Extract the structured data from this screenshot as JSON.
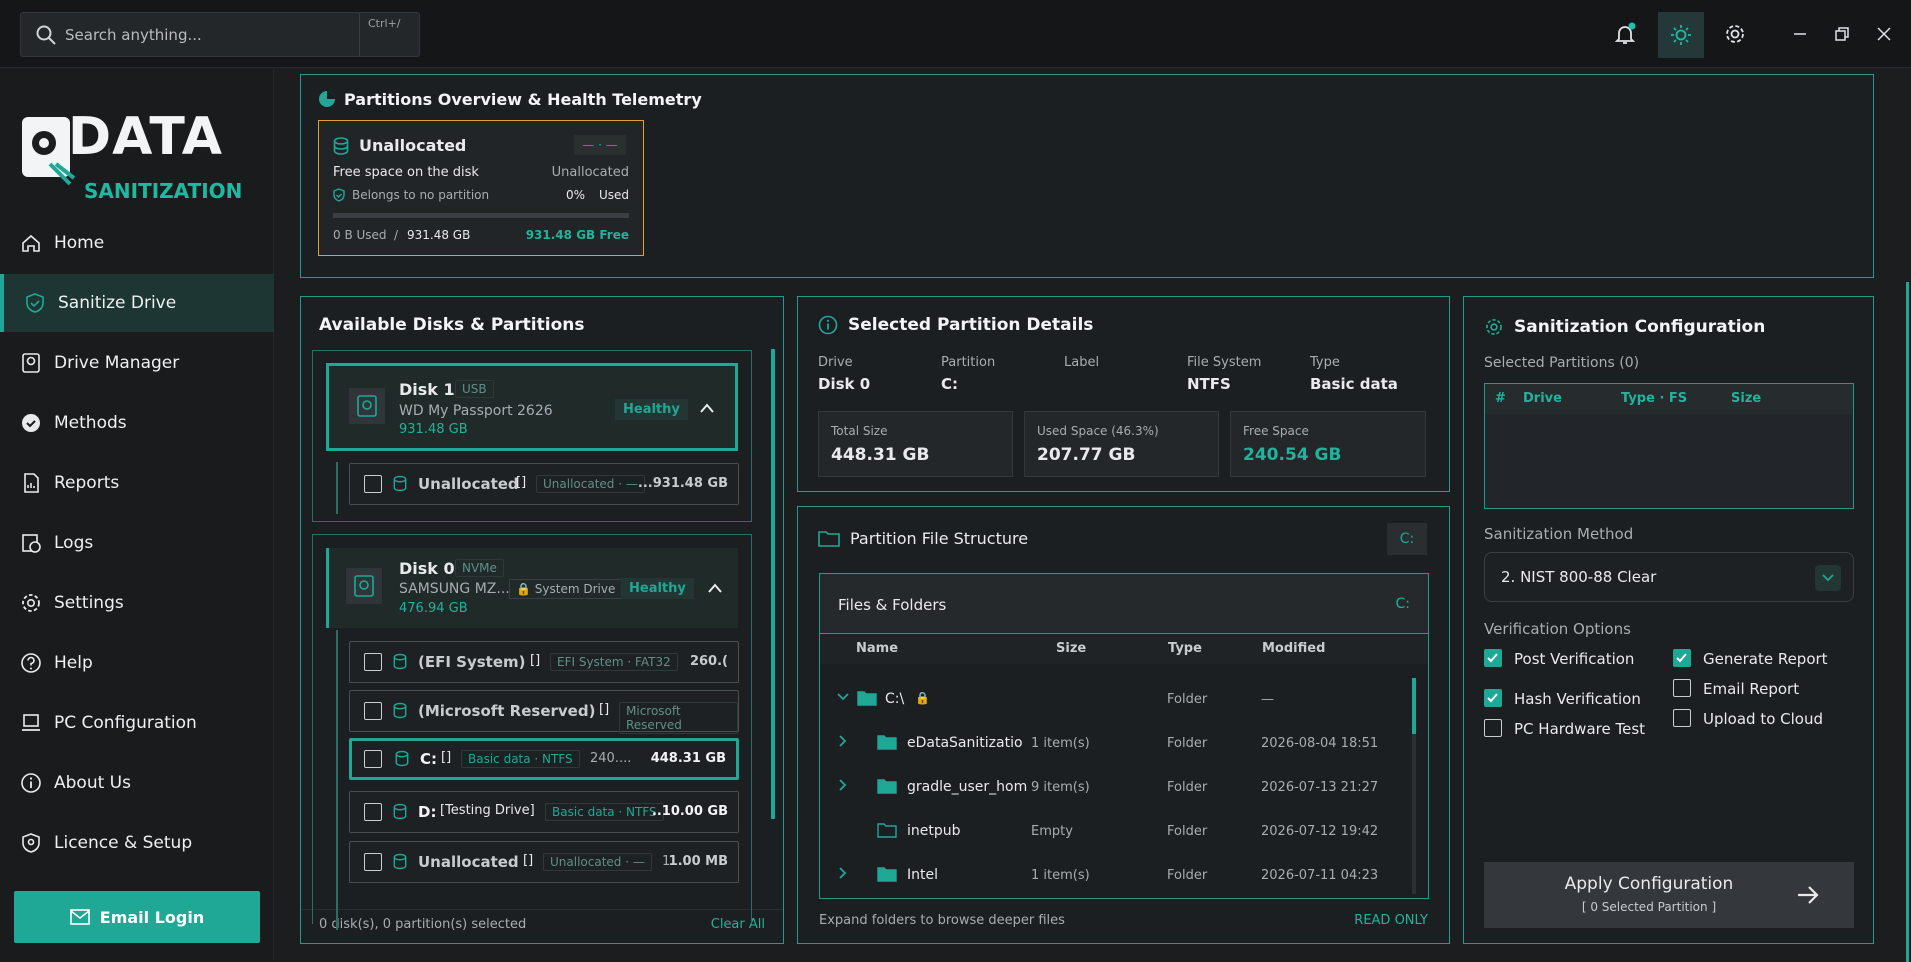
{
  "header": {
    "search_placeholder": "Search anything...",
    "shortcut": "Ctrl+/"
  },
  "brand": {
    "line1": "DATA",
    "line2": "SANITIZATION"
  },
  "nav": [
    {
      "label": "Home",
      "icon": "home-icon"
    },
    {
      "label": "Sanitize Drive",
      "icon": "shield-icon"
    },
    {
      "label": "Drive Manager",
      "icon": "drive-icon"
    },
    {
      "label": "Methods",
      "icon": "badge-check-icon"
    },
    {
      "label": "Reports",
      "icon": "report-icon"
    },
    {
      "label": "Logs",
      "icon": "logs-icon"
    },
    {
      "label": "Settings",
      "icon": "gear-icon"
    },
    {
      "label": "Help",
      "icon": "help-icon"
    },
    {
      "label": "PC Configuration",
      "icon": "laptop-icon"
    },
    {
      "label": "About Us",
      "icon": "info-icon"
    },
    {
      "label": "Licence & Setup",
      "icon": "license-icon"
    }
  ],
  "email_login": "Email Login",
  "overview": {
    "title": "Partitions Overview & Health Telemetry",
    "card": {
      "name": "Unallocated",
      "badge": "— · —",
      "desc": "Free space on the disk",
      "type": "Unallocated",
      "note": "Belongs to no partition",
      "pct": "0%",
      "pct_label": "Used",
      "used": "0 B Used",
      "sep": "/",
      "total": "931.48 GB",
      "free": "931.48 GB Free"
    }
  },
  "disks": {
    "title": "Available Disks & Partitions",
    "disk1": {
      "name": "Disk 1",
      "bus": "USB",
      "model": "WD My Passport 2626",
      "size": "931.48 GB",
      "health": "Healthy"
    },
    "disk1_parts": [
      {
        "name": "Unallocated",
        "bracket": "[]",
        "pill": "Unallocated · —",
        "size": "...931.48 GB"
      }
    ],
    "disk0": {
      "name": "Disk 0",
      "bus": "NVMe",
      "model": "SAMSUNG MZ...",
      "system": "System Drive",
      "size": "476.94 GB",
      "health": "Healthy"
    },
    "disk0_parts": [
      {
        "name": "(EFI System)",
        "bracket": "[]",
        "pill": "EFI System · FAT32",
        "size": "260.("
      },
      {
        "name": "(Microsoft Reserved)",
        "bracket": "[]",
        "pill": "Microsoft Reserved",
        "size": ""
      },
      {
        "name": "C:",
        "bracket": "[]",
        "pill": "Basic data · NTFS",
        "extra": "240....",
        "size": "448.31 GB"
      },
      {
        "name": "D:",
        "bracket": "[Testing Drive]",
        "pill": "Basic data · NTFS",
        "size": "..10.00 GB"
      },
      {
        "name": "Unallocated",
        "bracket": "[]",
        "pill": "Unallocated · —",
        "extra": "1....",
        "size": "1.00 MB"
      }
    ],
    "footer": "0 disk(s), 0 partition(s) selected",
    "clear": "Clear All"
  },
  "details": {
    "title": "Selected Partition Details",
    "cols": [
      {
        "k": "Drive",
        "v": "Disk 0"
      },
      {
        "k": "Partition",
        "v": "C:"
      },
      {
        "k": "Label",
        "v": ""
      },
      {
        "k": "File System",
        "v": "NTFS"
      },
      {
        "k": "Type",
        "v": "Basic data"
      }
    ],
    "total_label": "Total Size",
    "total": "448.31 GB",
    "used_label": "Used Space (46.3%)",
    "used": "207.77 GB",
    "free_label": "Free Space",
    "free": "240.54 GB"
  },
  "files": {
    "title": "Partition File Structure",
    "drive": "C:",
    "sub": "Files & Folders",
    "sub_drive": "C:",
    "cols": [
      "Name",
      "Size",
      "Type",
      "Modified"
    ],
    "root": {
      "name": "C:\\",
      "type": "Folder",
      "modified": "—"
    },
    "rows": [
      {
        "name": "eDataSanitizatio",
        "size": "1 item(s)",
        "type": "Folder",
        "modified": "2026-08-04 18:51",
        "expand": true
      },
      {
        "name": "gradle_user_hom",
        "size": "9 item(s)",
        "type": "Folder",
        "modified": "2026-07-13 21:27",
        "expand": true
      },
      {
        "name": "inetpub",
        "size": "Empty",
        "type": "Folder",
        "modified": "2026-07-12 19:42",
        "expand": false
      },
      {
        "name": "Intel",
        "size": "1 item(s)",
        "type": "Folder",
        "modified": "2026-07-11 04:23",
        "expand": true
      }
    ],
    "footer": "Expand folders to browse deeper files",
    "readonly": "READ ONLY"
  },
  "config": {
    "title": "Sanitization Configuration",
    "selected": "Selected Partitions (0)",
    "table_cols": [
      "#",
      "Drive",
      "Type · FS",
      "Size"
    ],
    "method_label": "Sanitization Method",
    "method": "2. NIST 800-88 Clear",
    "verify_label": "Verification Options",
    "options": [
      {
        "label": "Post Verification",
        "checked": true
      },
      {
        "label": "Generate Report",
        "checked": true
      },
      {
        "label": "Email Report",
        "checked": false
      },
      {
        "label": "Hash Verification",
        "checked": true
      },
      {
        "label": "PC Hardware Test",
        "checked": false
      },
      {
        "label": "Upload to Cloud",
        "checked": false
      }
    ],
    "apply": "Apply Configuration",
    "apply_sub": "[ 0 Selected Partition ]"
  },
  "colors": {
    "accent": "#1fa896",
    "bg": "#1b1d1f",
    "warn": "#e0a030"
  }
}
